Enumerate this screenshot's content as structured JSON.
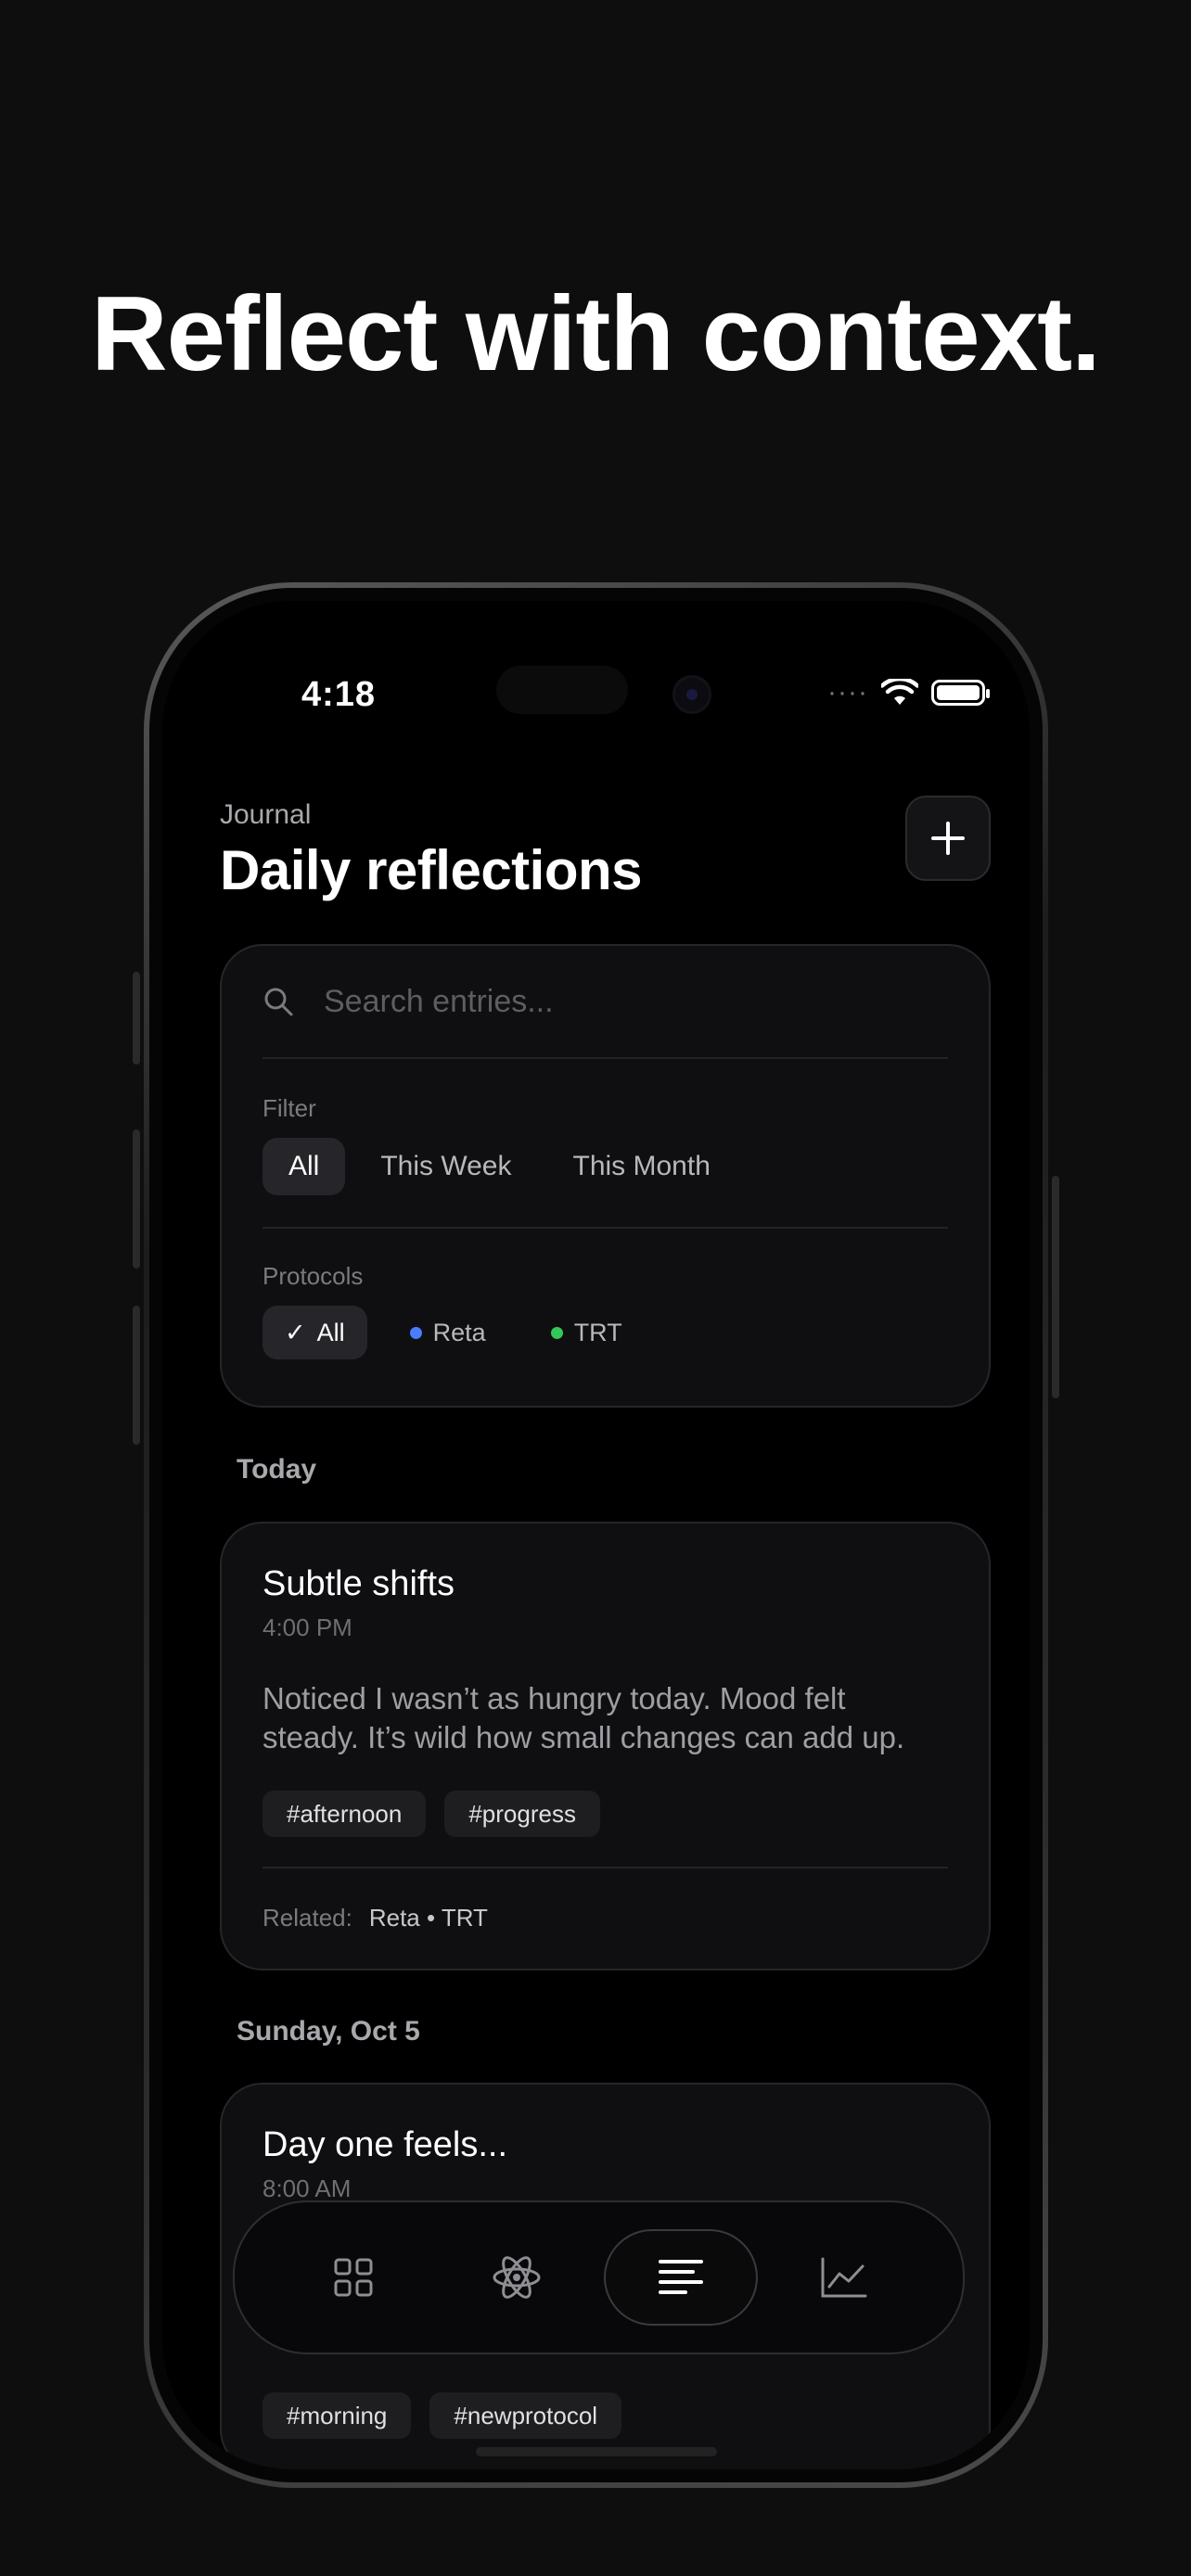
{
  "marketing": {
    "headline": "Reflect with context."
  },
  "status_bar": {
    "time": "4:18",
    "signal": "····"
  },
  "header": {
    "section": "Journal",
    "title": "Daily reflections",
    "add_icon": "plus-icon"
  },
  "search": {
    "placeholder": "Search entries...",
    "value": ""
  },
  "filter": {
    "label": "Filter",
    "options": [
      "All",
      "This Week",
      "This Month"
    ],
    "selected": "All"
  },
  "protocols": {
    "label": "Protocols",
    "options": [
      {
        "label": "All",
        "prefix": "✓",
        "selected": true
      },
      {
        "label": "Reta",
        "color": "#4a7dff",
        "selected": false
      },
      {
        "label": "TRT",
        "color": "#34c759",
        "selected": false
      }
    ]
  },
  "groups": [
    {
      "day": "Today",
      "entries": [
        {
          "title": "Subtle shifts",
          "time": "4:00 PM",
          "body": "Noticed I wasn’t as hungry today. Mood felt steady. It’s wild how small changes can add up.",
          "tags": [
            "#afternoon",
            "#progress"
          ],
          "related_label": "Related:",
          "related_value": "Reta • TRT"
        }
      ]
    },
    {
      "day": "Sunday, Oct 5",
      "entries": [
        {
          "title": "Day one feels...",
          "time": "8:00 AM",
          "tags": [
            "#morning",
            "#newprotocol"
          ]
        }
      ]
    }
  ],
  "tab_bar": {
    "tabs": [
      {
        "icon": "grid-icon",
        "active": false
      },
      {
        "icon": "atom-icon",
        "active": false
      },
      {
        "icon": "journal-lines-icon",
        "active": true
      },
      {
        "icon": "chart-icon",
        "active": false
      }
    ]
  }
}
